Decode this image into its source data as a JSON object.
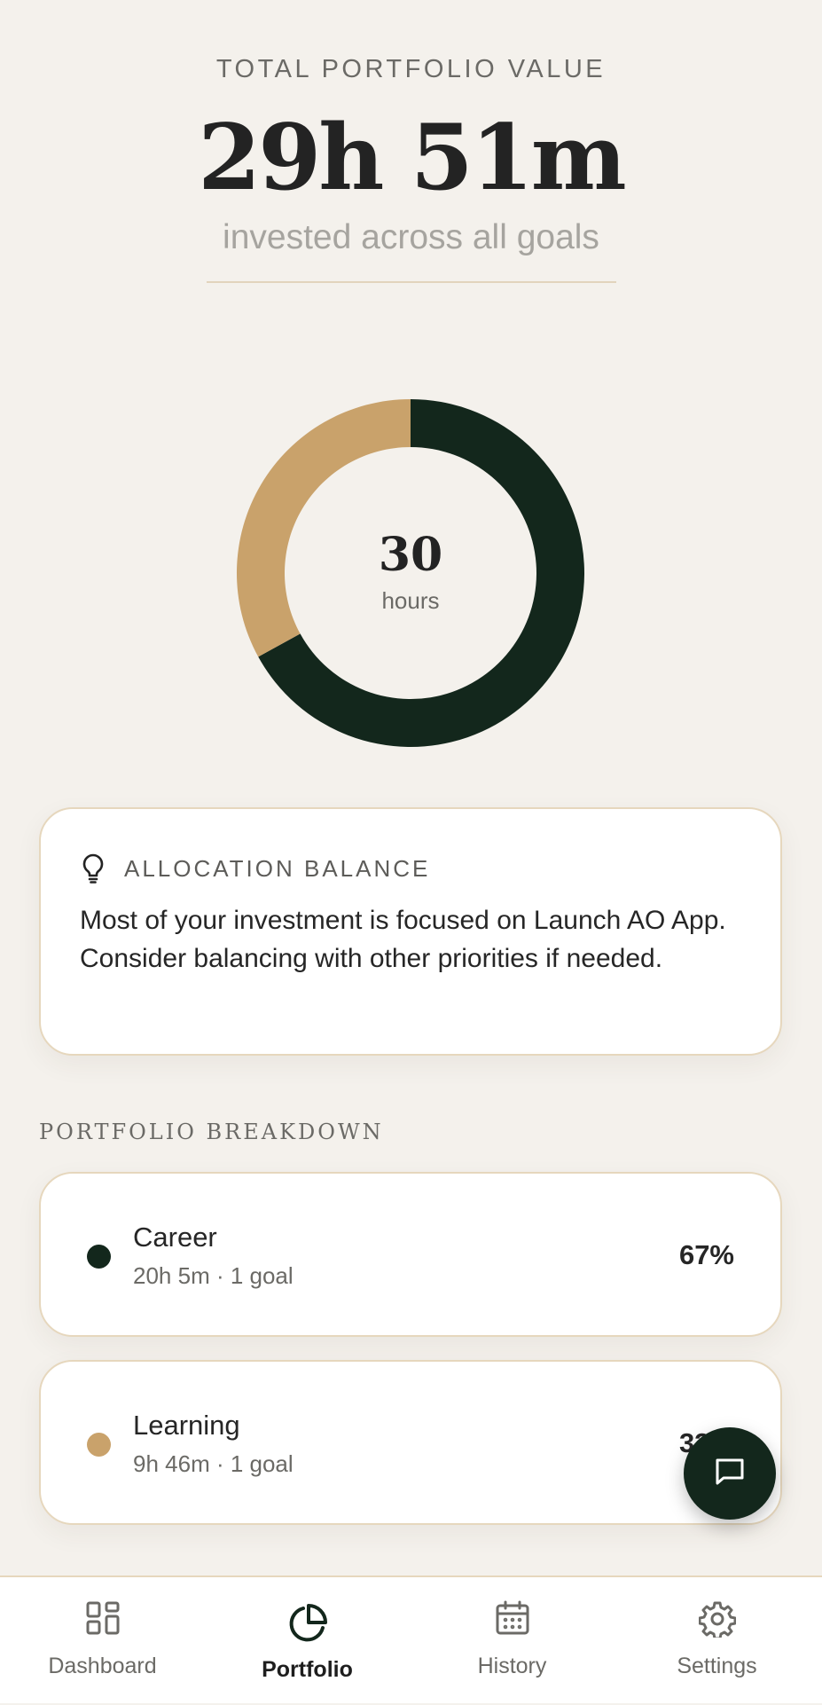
{
  "header": {
    "eyebrow": "TOTAL PORTFOLIO VALUE",
    "total": "29h 51m",
    "subline": "invested across all goals"
  },
  "chart_data": {
    "type": "pie",
    "style": "donut",
    "center_value": "30",
    "center_label": "hours",
    "categories": [
      "Career",
      "Learning"
    ],
    "values": [
      67,
      33
    ],
    "colors": [
      "#13271c",
      "#c9a26b"
    ]
  },
  "insight": {
    "icon": "lightbulb-icon",
    "title": "ALLOCATION BALANCE",
    "text": "Most of your investment is focused on Launch AO App. Consider balancing with other priorities if needed."
  },
  "breakdown": {
    "title": "PORTFOLIO BREAKDOWN",
    "items": [
      {
        "name": "Career",
        "meta": "20h 5m · 1 goal",
        "pct": "67%",
        "color": "#13271c"
      },
      {
        "name": "Learning",
        "meta": "9h 46m · 1 goal",
        "pct": "33%",
        "color": "#c9a26b"
      }
    ]
  },
  "fab": {
    "icon": "chat-icon"
  },
  "nav": {
    "items": [
      {
        "label": "Dashboard",
        "icon": "grid-icon"
      },
      {
        "label": "Portfolio",
        "icon": "pie-chart-icon",
        "active": true
      },
      {
        "label": "History",
        "icon": "calendar-icon"
      },
      {
        "label": "Settings",
        "icon": "gear-icon"
      }
    ]
  },
  "colors": {
    "background": "#f4f1ec",
    "accent_dark": "#13271c",
    "accent_gold": "#c9a26b",
    "card_border": "#e6d7bd"
  }
}
